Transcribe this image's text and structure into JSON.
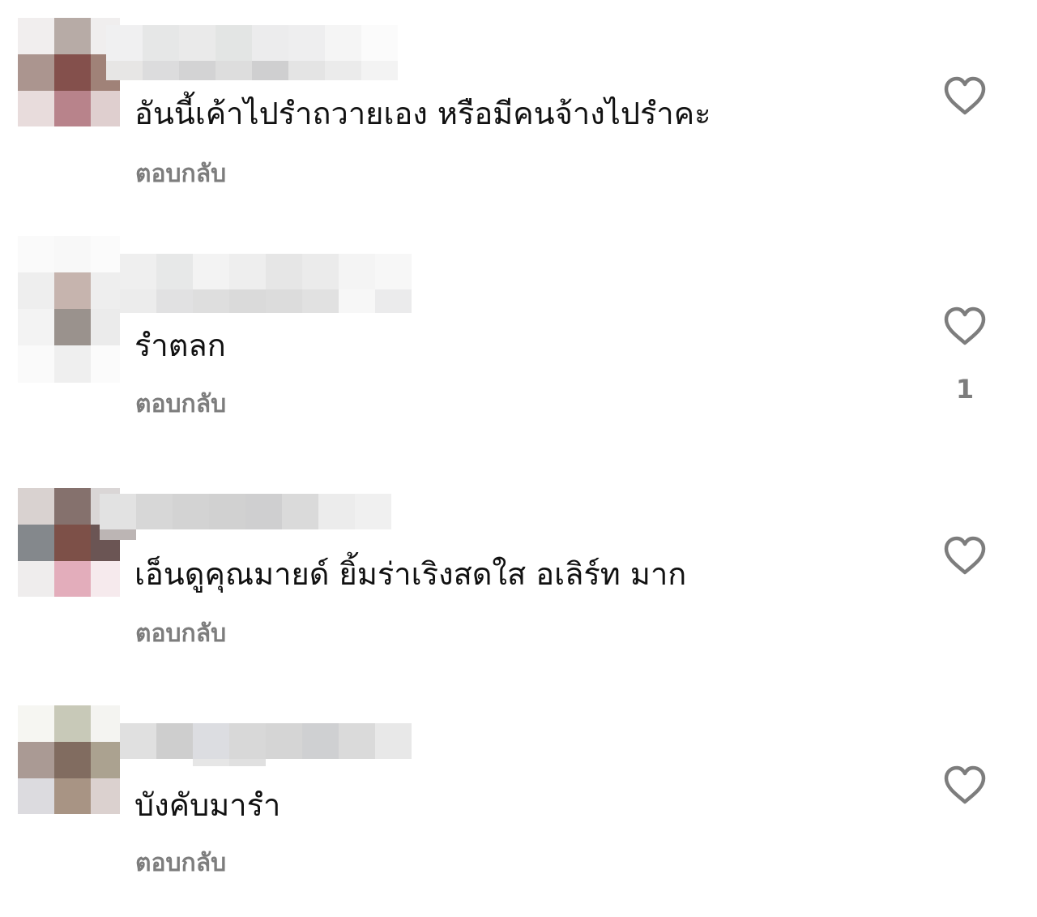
{
  "comments": [
    {
      "text": "อันนี้เค้าไปรำถวายเอง หรือมีคนจ้างไปรำคะ",
      "reply_label": "ตอบกลับ",
      "like_count": "",
      "avatar_colors": [
        "#f1eeee",
        "#b7aba6",
        "#f0eeee",
        "#ab958f",
        "#84504c",
        "#a08278",
        "#e8dcdc",
        "#b8838b",
        "#dfcfcf"
      ],
      "username_colors_top": [
        "#f0f0f1",
        "#e6e7e7",
        "#eaeaea",
        "#e3e5e4",
        "#ececed",
        "#eeeeef",
        "#f5f5f5",
        "#fbfbfb"
      ],
      "username_colors_bot": [
        "#e7e6e5",
        "#dcdcdd",
        "#d3d3d4",
        "#dddddd",
        "#cfcfd0",
        "#e4e4e4",
        "#ebebeb",
        "#f3f3f3"
      ]
    },
    {
      "text": "รำตลก",
      "reply_label": "ตอบกลับ",
      "like_count": "1",
      "avatar_colors": [
        "#fafafa",
        "#f8f8f8",
        "#fbfbfb",
        "#eeeeee",
        "#c6b4ae",
        "#eeeeee",
        "#f3f3f3",
        "#9a928d",
        "#ebebeb",
        "#fafafa",
        "#efefef",
        "#fbfbfb"
      ],
      "username_colors_top": [
        "#efefef",
        "#e7e8e8",
        "#f3f3f3",
        "#eeeeee",
        "#e6e6e6",
        "#ebebeb",
        "#f4f4f4",
        "#f7f7f7"
      ],
      "username_colors_bot": [
        "#ececec",
        "#e1e1e2",
        "#dedede",
        "#dadada",
        "#dcdcdc",
        "#e1e1e1",
        "#f7f7f7",
        "#ebebec"
      ]
    },
    {
      "text": "เอ็นดูคุณมายด์ ยิ้มร่าเริงสดใส อเลิร์ท มาก",
      "reply_label": "ตอบกลับ",
      "like_count": "",
      "avatar_colors": [
        "#d9d2d0",
        "#85716d",
        "#dad6d6",
        "#84888c",
        "#7d5048",
        "#6b5554",
        "#efeded",
        "#e3adbb",
        "#f6eaed"
      ],
      "username_colors_top": [
        "#e2e2e2",
        "#d7d7d7",
        "#d3d3d3",
        "#d1d1d1",
        "#cfcfd0",
        "#dadada",
        "#ececec",
        "#f0f0f0"
      ],
      "username_colors_bot": [
        "#bcb5b4",
        "#ffffff",
        "#ffffff",
        "#ffffff",
        "#ffffff",
        "#ffffff",
        "#ffffff",
        "#ffffff"
      ]
    },
    {
      "text": "บังคับมารำ",
      "reply_label": "ตอบกลับ",
      "like_count": "",
      "avatar_colors": [
        "#f6f6f2",
        "#c8c9b8",
        "#f4f4f1",
        "#aa9a94",
        "#816c60",
        "#aba290",
        "#dcdbdf",
        "#a89484",
        "#dbd1cf"
      ],
      "username_colors_top": [
        "#e0e0e0",
        "#cecece",
        "#dcdde1",
        "#d8d8d8",
        "#d5d5d5",
        "#cfd0d2",
        "#dadada",
        "#e8e8e8"
      ],
      "username_colors_bot": [
        "#ffffff",
        "#ffffff",
        "#e6e6e6",
        "#e0e0e0",
        "#ffffff",
        "#ffffff",
        "#ffffff",
        "#ffffff"
      ]
    }
  ],
  "icons": {
    "like": "heart-outline-icon"
  },
  "colors": {
    "reply_text": "#7d7d7d",
    "heart_stroke": "#7d7d7d",
    "body_text": "#111111"
  }
}
